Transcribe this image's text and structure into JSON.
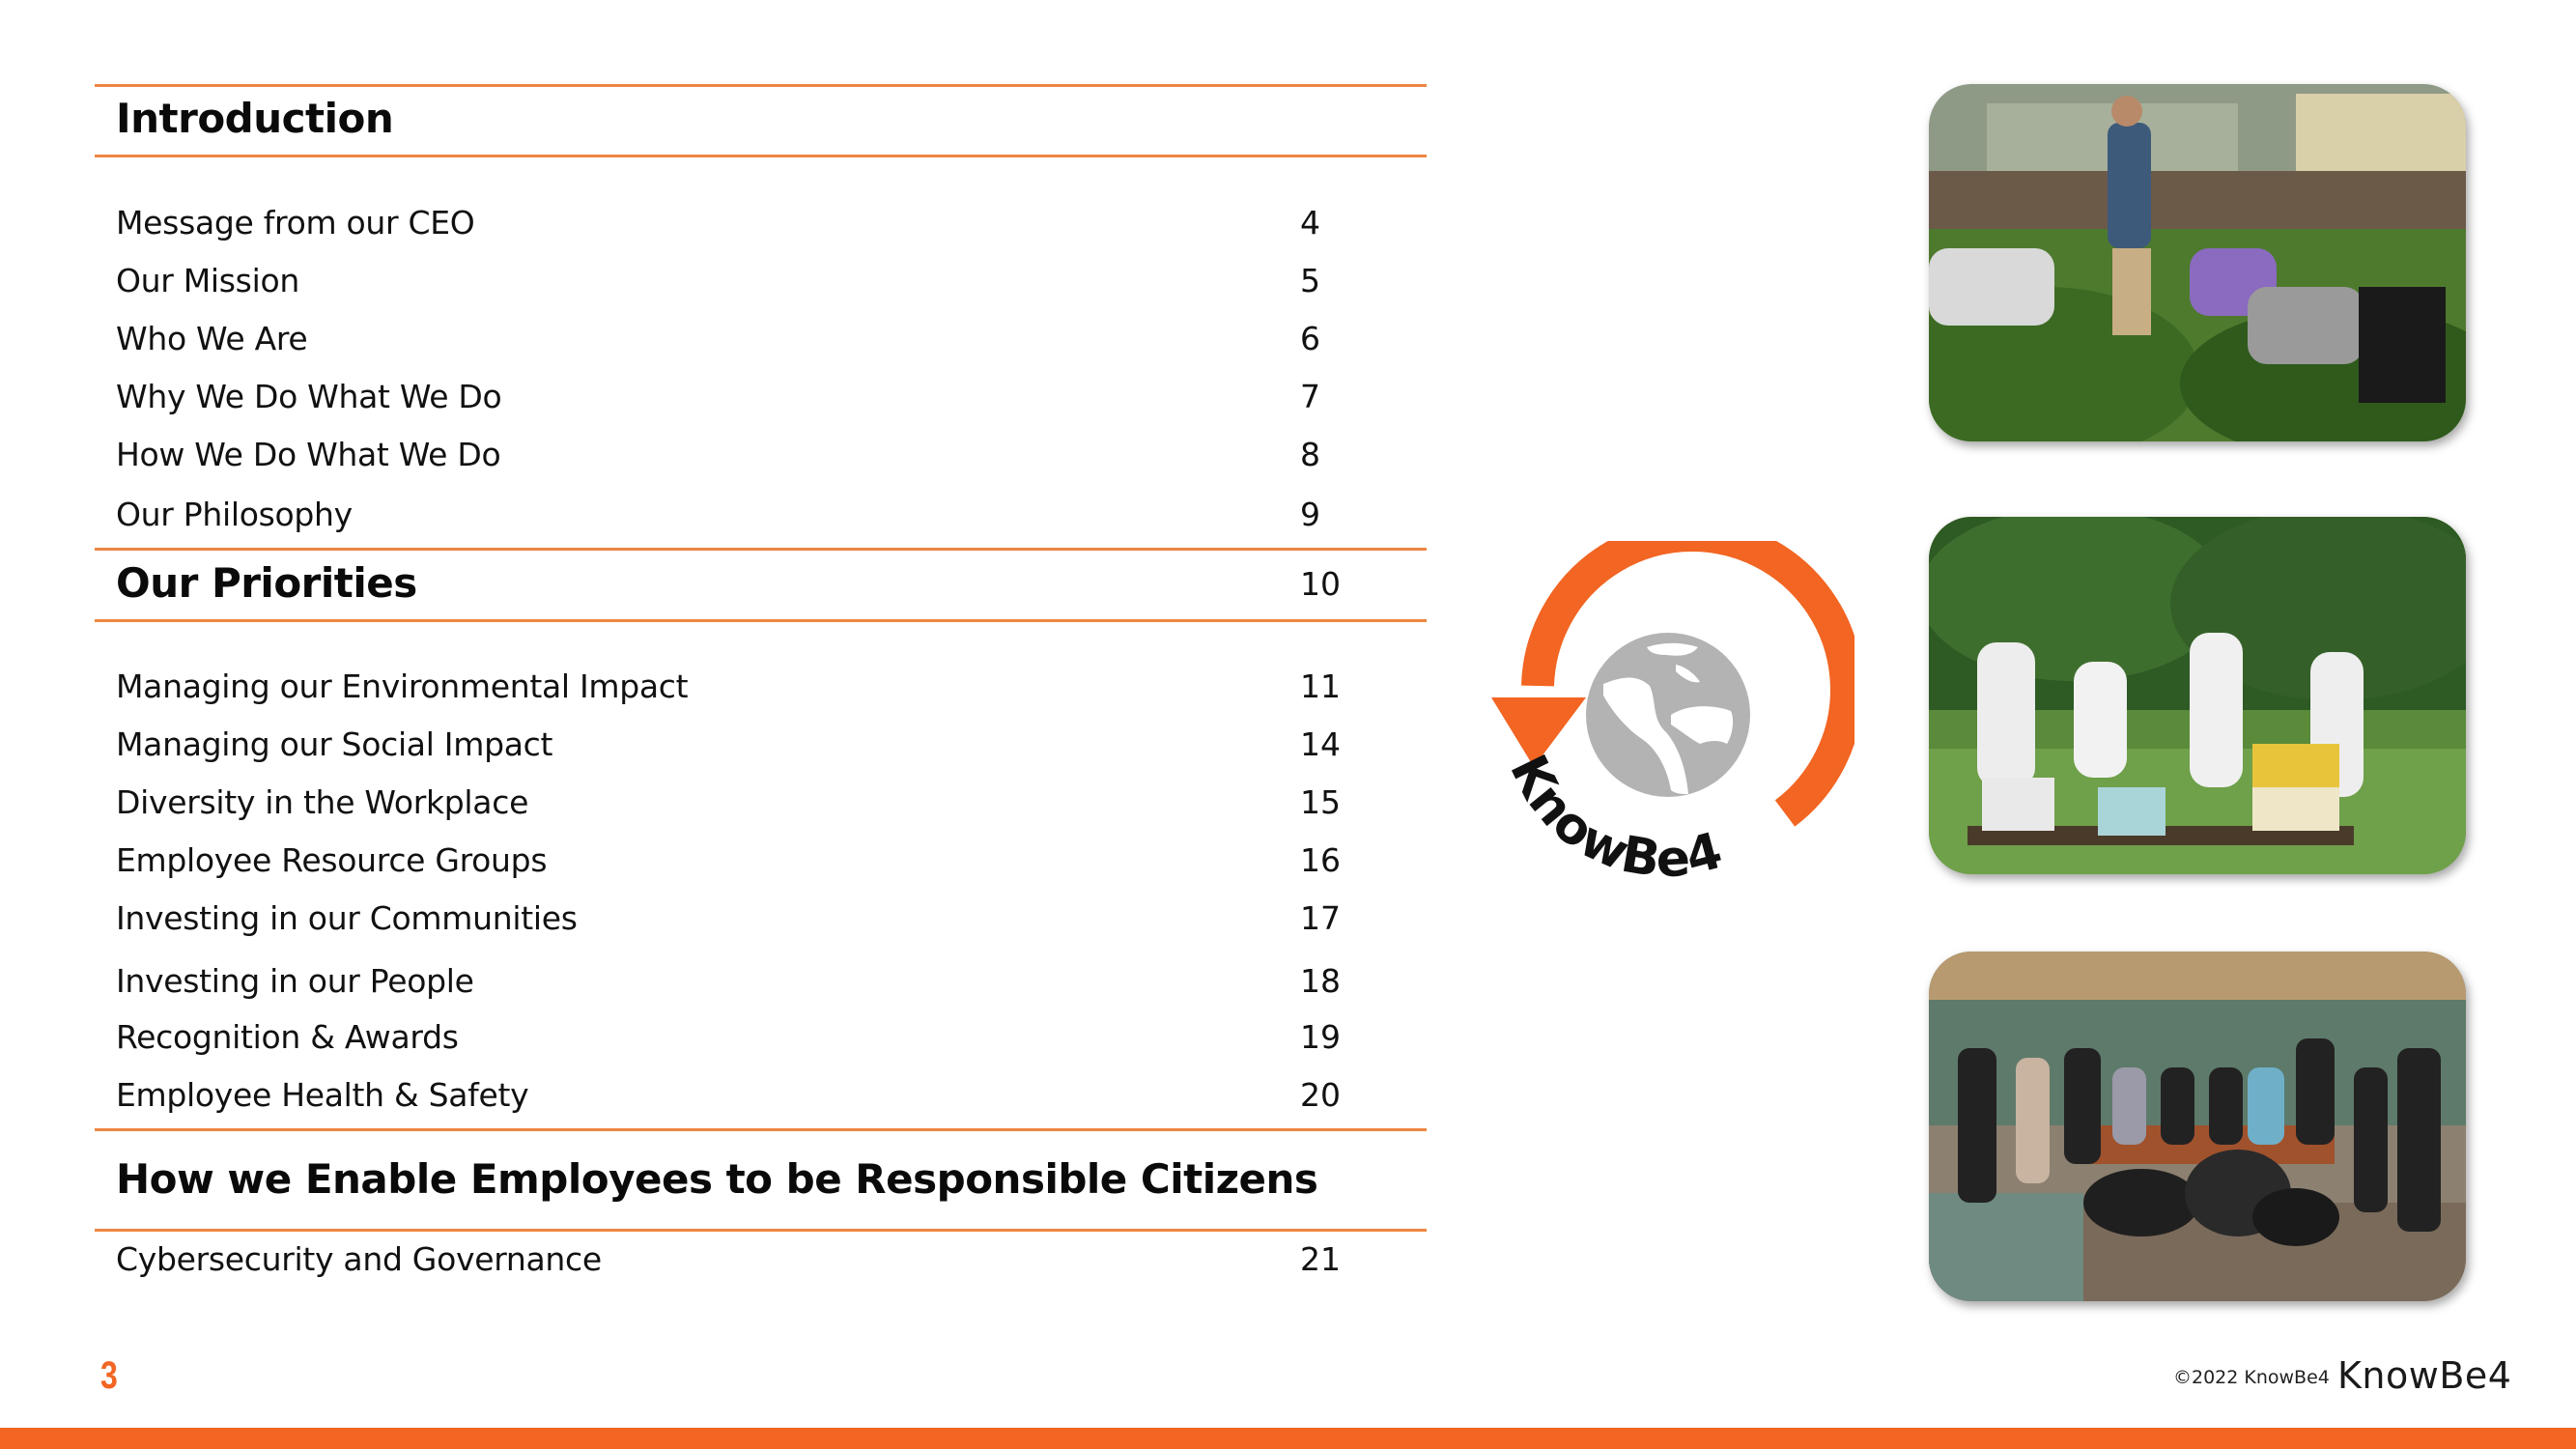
{
  "brand": {
    "name": "KnowBe4",
    "accent_color": "#F26522",
    "rule_color": "#EE8642",
    "globe_color": "#B3B3B3"
  },
  "sections": [
    {
      "title": "Introduction",
      "page": "",
      "items": [
        {
          "label": "Message from our CEO",
          "page": "4"
        },
        {
          "label": "Our Mission",
          "page": "5"
        },
        {
          "label": "Who We Are",
          "page": "6"
        },
        {
          "label": "Why We Do What We Do",
          "page": "7"
        },
        {
          "label": "How We Do What We Do",
          "page": "8"
        },
        {
          "label": "Our Philosophy",
          "page": "9"
        }
      ]
    },
    {
      "title": "Our Priorities",
      "page": "10",
      "items": [
        {
          "label": "Managing our Environmental Impact",
          "page": "11"
        },
        {
          "label": "Managing our Social Impact",
          "page": "14"
        },
        {
          "label": "Diversity in the Workplace",
          "page": "15"
        },
        {
          "label": "Employee Resource Groups",
          "page": "16"
        },
        {
          "label": "Investing in our Communities",
          "page": "17"
        },
        {
          "label": "Investing in our People",
          "page": "18"
        },
        {
          "label": "Recognition & Awards",
          "page": "19"
        },
        {
          "label": "Employee Health & Safety",
          "page": "20"
        }
      ]
    },
    {
      "title": "How we Enable Employees to be Responsible Citizens",
      "page": "",
      "items": [
        {
          "label": "Cybersecurity and Governance",
          "page": "21"
        }
      ]
    }
  ],
  "logo": {
    "text": "KnowBe4",
    "icon": "globe-with-circular-arrow-icon"
  },
  "photos": [
    {
      "description": "Volunteers gardening and clearing weeds in a backyard"
    },
    {
      "description": "Volunteers in beekeeping suits beside KnowBe4 bee hives"
    },
    {
      "description": "Group of employees indoors with collected trash bags"
    }
  ],
  "footer": {
    "page_number": "3",
    "copyright": "©2022 KnowBe4",
    "brand_wordmark": "KnowBe4"
  }
}
